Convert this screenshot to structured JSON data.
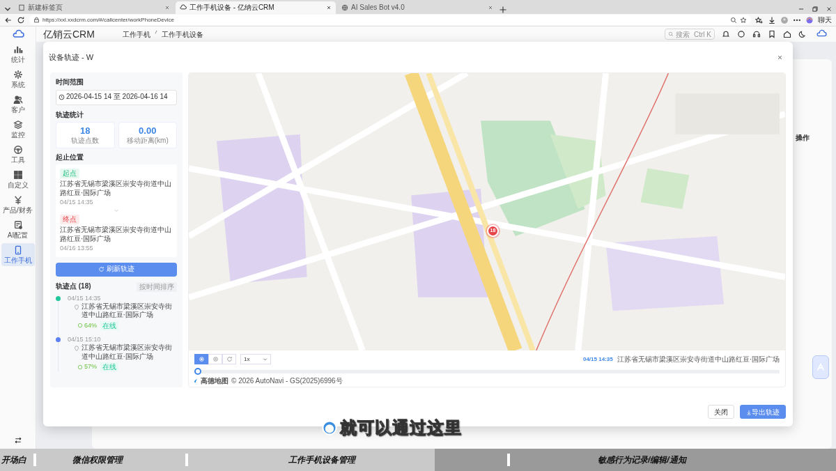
{
  "browser": {
    "tabs": [
      {
        "title": "新建标签页",
        "selected": false
      },
      {
        "title": "工作手机设备 - 亿纳云CRM",
        "selected": true
      },
      {
        "title": "AI Sales Bot v4.0",
        "selected": false
      }
    ],
    "url": "https://xxl.xxdcrm.com/#/callcenter/workPhoneDevice",
    "chat_label": "聊天"
  },
  "app": {
    "brand": "亿销云CRM",
    "breadcrumb": [
      "工作手机",
      "工作手机设备"
    ],
    "search": {
      "placeholder": "搜索",
      "shortcut": "Ctrl K"
    },
    "sidebar": {
      "items": [
        {
          "label": "统计",
          "selected": false
        },
        {
          "label": "系统",
          "selected": false
        },
        {
          "label": "客户",
          "selected": false
        },
        {
          "label": "监控",
          "selected": false
        },
        {
          "label": "工具",
          "selected": false
        },
        {
          "label": "自定义",
          "selected": false
        },
        {
          "label": "产品/财务",
          "selected": false
        },
        {
          "label": "AI配置",
          "selected": false
        },
        {
          "label": "工作手机",
          "selected": true
        }
      ]
    },
    "table": {
      "columns": [
        "操作"
      ]
    }
  },
  "modal": {
    "title": "设备轨迹 - W",
    "time_range": {
      "label": "时间范围",
      "value": "2026-04-15 14 至 2026-04-16 14"
    },
    "stats": {
      "label": "轨迹统计",
      "items": [
        {
          "value": "18",
          "label": "轨迹点数"
        },
        {
          "value": "0.00",
          "label": "移动距离(km)"
        }
      ]
    },
    "endpoints": {
      "label": "起止位置",
      "items": [
        {
          "kind": "start",
          "tag": "起点",
          "address": "江苏省无锡市梁溪区崇安寺街道中山路红豆·国际广场",
          "time": "04/15 14:35"
        },
        {
          "kind": "end",
          "tag": "终点",
          "address": "江苏省无锡市梁溪区崇安寺街道中山路红豆·国际广场",
          "time": "04/16 13:55"
        }
      ]
    },
    "refresh_button": "刷新轨迹",
    "points": {
      "label": "轨迹点 (18)",
      "sort_button": "按时间排序",
      "items": [
        {
          "time": "04/15 14:35",
          "address": "江苏省无锡市梁溪区崇安寺街道中山路红豆·国际广场",
          "battery": "64%",
          "status": "在线",
          "color": "#1fc79a"
        },
        {
          "time": "04/15 15:10",
          "address": "江苏省无锡市梁溪区崇安寺街道中山路红豆·国际广场",
          "battery": "57%",
          "status": "在线",
          "color": "#5b7ff0"
        }
      ]
    },
    "map": {
      "marker_label": "18",
      "controls": [
        {
          "kind": "play",
          "selected": true
        },
        {
          "kind": "point",
          "selected": false
        },
        {
          "kind": "reset",
          "selected": false
        }
      ],
      "speed": "1x",
      "current_time": "04/15 14:35",
      "current_address": "江苏省无锡市梁溪区崇安寺街道中山路红豆·国际广场",
      "timeline": {
        "level": 0
      },
      "provider": "高德地图",
      "copyright": "© 2026 AutoNavi - GS(2025)6996号"
    },
    "buttons": [
      {
        "label": "关闭",
        "kind": "secondary"
      },
      {
        "label": "导出轨迹",
        "kind": "primary"
      }
    ]
  },
  "video": {
    "subtitle": "就可以通过这里",
    "progress": {
      "level": 0.52
    },
    "chapters": [
      {
        "label": "开场白"
      },
      {
        "label": "微信权限管理"
      },
      {
        "label": "工作手机设备管理"
      },
      {
        "label": "敏感行为记录/编辑/通知"
      }
    ]
  }
}
